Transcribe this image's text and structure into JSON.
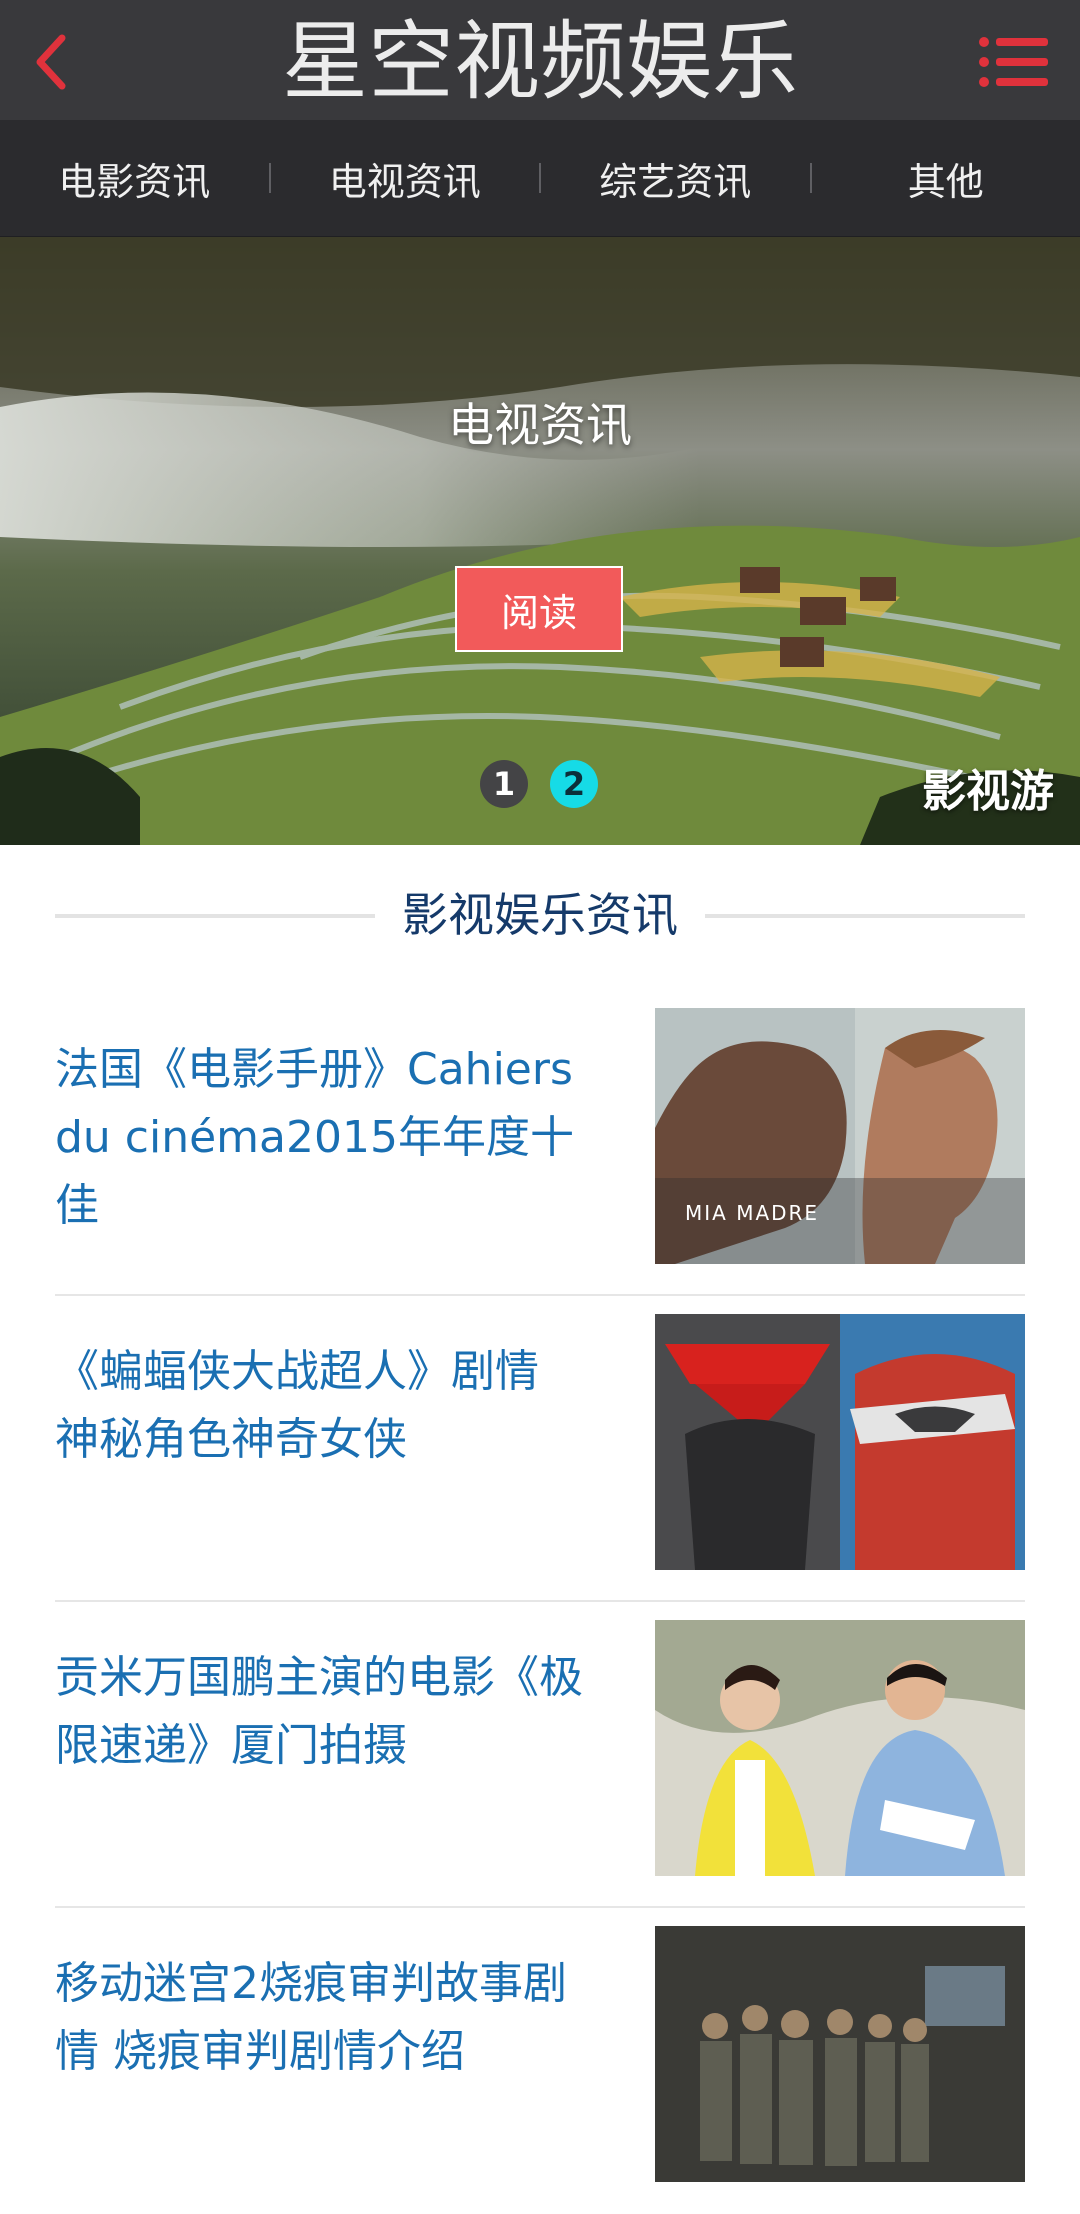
{
  "header": {
    "title": "星空视频娱乐",
    "back_icon": "chevron-left-icon",
    "menu_icon": "menu-icon",
    "accent": "#e0323c"
  },
  "nav": {
    "items": [
      {
        "label": "电影资讯"
      },
      {
        "label": "电视资讯"
      },
      {
        "label": "综艺资讯"
      },
      {
        "label": "其他"
      }
    ]
  },
  "banner": {
    "title": "电视资讯",
    "read_label": "阅读",
    "dots": [
      "1",
      "2"
    ],
    "active_dot": 2,
    "watermark": "影视游"
  },
  "section": {
    "title": "影视娱乐资讯"
  },
  "news": [
    {
      "title": "法国《电影手册》Cahiers du cinéma2015年年度十佳",
      "thumb_text": "MIA MADRE"
    },
    {
      "title": "《蝙蝠侠大战超人》剧情 神秘角色神奇女侠"
    },
    {
      "title": "贡米万国鹏主演的电影《极限速递》厦门拍摄"
    },
    {
      "title": "移动迷宫2烧痕审判故事剧情 烧痕审判剧情介绍"
    }
  ]
}
